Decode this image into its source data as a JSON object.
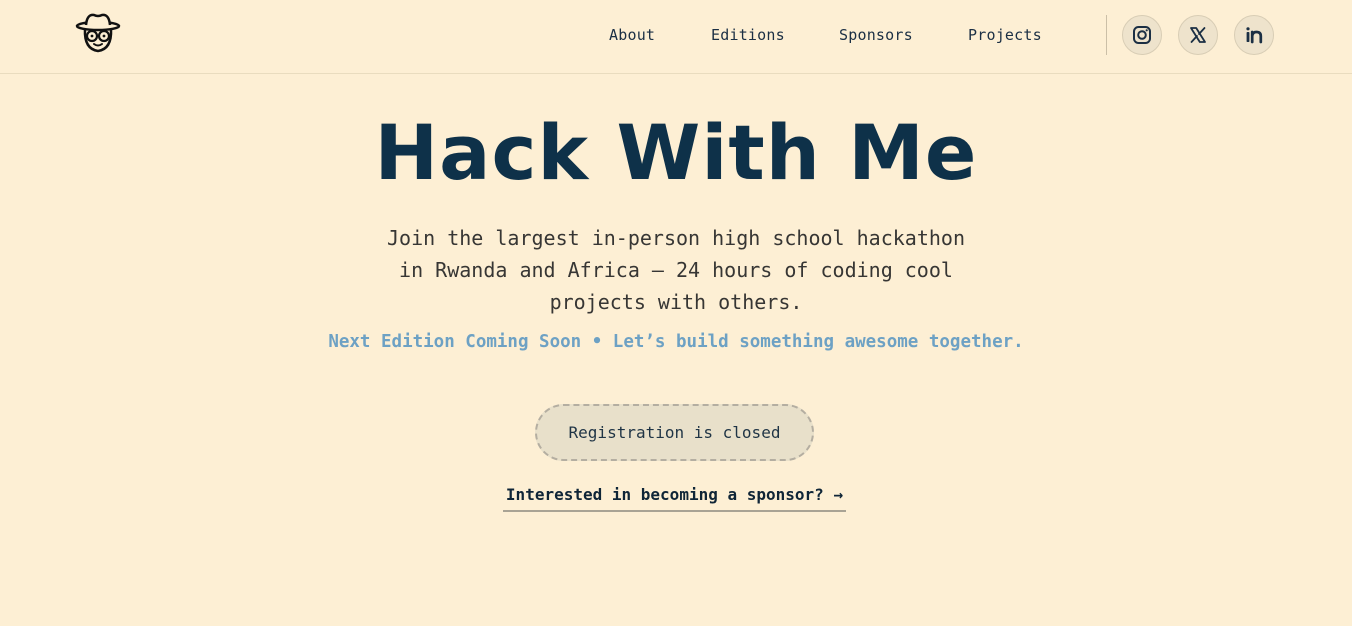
{
  "header": {
    "logo_icon": "hacker-mascot-icon",
    "nav": [
      {
        "label": "About"
      },
      {
        "label": "Editions"
      },
      {
        "label": "Sponsors"
      },
      {
        "label": "Projects"
      }
    ],
    "socials": [
      {
        "icon": "instagram-icon"
      },
      {
        "icon": "x-icon"
      },
      {
        "icon": "linkedin-icon"
      }
    ]
  },
  "hero": {
    "title": "Hack With Me",
    "subtitle": "Join the largest in-person high school hackathon in Rwanda and Africa — 24 hours of coding cool projects with others.",
    "tagline": "Next Edition Coming Soon • Let’s build something awesome together.",
    "registration_label": "Registration is closed",
    "sponsor_link": "Interested in becoming a sponsor? →"
  },
  "colors": {
    "background": "#fdefd4",
    "title": "#0e3149",
    "tagline": "#6da1c4",
    "button_bg": "#e8e0ca"
  }
}
